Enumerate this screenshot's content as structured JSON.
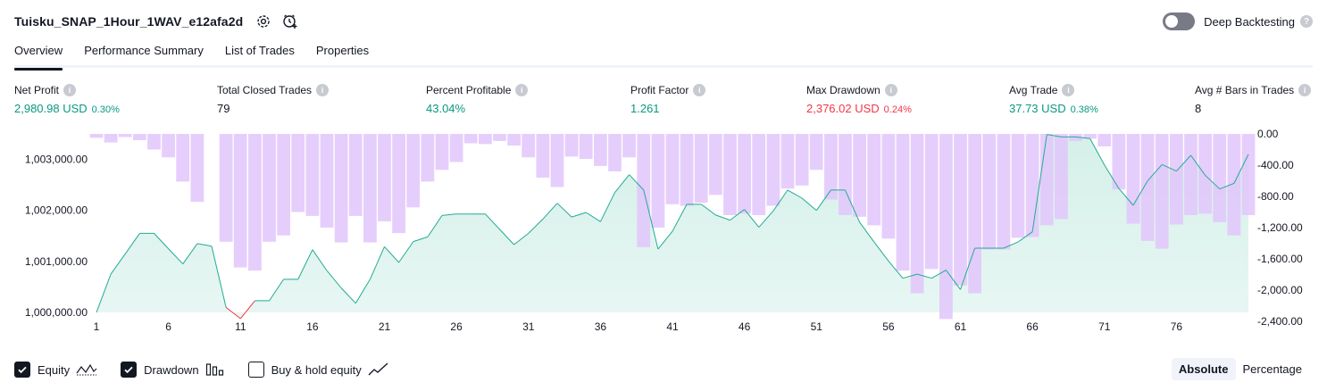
{
  "header": {
    "strategy_name": "Tuisku_SNAP_1Hour_1WAV_e12afa2d",
    "icons": [
      "settings-icon",
      "add-alert-icon"
    ]
  },
  "deep_backtesting": {
    "label": "Deep Backtesting",
    "enabled": false,
    "help": "?"
  },
  "tabs": [
    {
      "label": "Overview",
      "active": true
    },
    {
      "label": "Performance Summary",
      "active": false
    },
    {
      "label": "List of Trades",
      "active": false
    },
    {
      "label": "Properties",
      "active": false
    }
  ],
  "metrics": {
    "net_profit": {
      "label": "Net Profit",
      "value": "2,980.98 USD",
      "pct": "0.30%"
    },
    "total_closed_trades": {
      "label": "Total Closed Trades",
      "value": "79"
    },
    "percent_profitable": {
      "label": "Percent Profitable",
      "value": "43.04%"
    },
    "profit_factor": {
      "label": "Profit Factor",
      "value": "1.261"
    },
    "max_drawdown": {
      "label": "Max Drawdown",
      "value": "2,376.02 USD",
      "pct": "0.24%"
    },
    "avg_trade": {
      "label": "Avg Trade",
      "value": "37.73 USD",
      "pct": "0.38%"
    },
    "avg_bars": {
      "label": "Avg # Bars in Trades",
      "value": "8"
    }
  },
  "colors": {
    "equity_line": "#22ab94",
    "equity_fill": "#d5f0e9",
    "equity_negative": "#f23645",
    "drawdown_bar": "#e2c6fb",
    "drawdown_overlap": "#b9b5ec",
    "text_green": "#089981",
    "text_red": "#f23645"
  },
  "chart_data": {
    "type": "area",
    "x_ticks": [
      "1",
      "6",
      "11",
      "16",
      "21",
      "26",
      "31",
      "36",
      "41",
      "46",
      "51",
      "56",
      "61",
      "66",
      "71",
      "76"
    ],
    "y_left_ticks": [
      "1,000,000.00",
      "1,001,000.00",
      "1,002,000.00",
      "1,003,000.00"
    ],
    "y_left_values": [
      1000000,
      1001000,
      1002000,
      1003000
    ],
    "y_left_range": [
      1000000,
      1003500
    ],
    "y_right_ticks": [
      "0.00",
      "-400.00",
      "-800.00",
      "-1,200.00",
      "-1,600.00",
      "-2,000.00",
      "-2,400.00"
    ],
    "y_right_values": [
      0,
      -400,
      -800,
      -1200,
      -1600,
      -2000,
      -2400
    ],
    "y_right_range": [
      -2400,
      0
    ],
    "series": [
      {
        "name": "Equity",
        "type": "area",
        "values": [
          1000000,
          1000750,
          1001150,
          1001550,
          1001550,
          1001250,
          1000950,
          1001350,
          1001300,
          1000100,
          999880,
          1000230,
          1000230,
          1000650,
          1000650,
          1001230,
          1000820,
          1000480,
          1000180,
          1000650,
          1001290,
          1000980,
          1001390,
          1001480,
          1001900,
          1001930,
          1001930,
          1001930,
          1001630,
          1001330,
          1001550,
          1001830,
          1002140,
          1001870,
          1001960,
          1001780,
          1002350,
          1002700,
          1002400,
          1001240,
          1001590,
          1002120,
          1002120,
          1001910,
          1001810,
          1002020,
          1001670,
          1001990,
          1002400,
          1002240,
          1002000,
          1002400,
          1002400,
          1001770,
          1001380,
          1001010,
          1000670,
          1000750,
          1000670,
          1000830,
          1000450,
          1001260,
          1001260,
          1001260,
          1001380,
          1001580,
          1003490,
          1003440,
          1003440,
          1003410,
          1002890,
          1002430,
          1002100,
          1002580,
          1002900,
          1002770,
          1003080,
          1002690,
          1002420,
          1002530,
          1003100
        ]
      },
      {
        "name": "Drawdown",
        "type": "bar",
        "values": [
          -50,
          -110,
          -40,
          -80,
          -200,
          -300,
          -610,
          -870,
          0,
          -1380,
          -1710,
          -1750,
          -1380,
          -1300,
          -1000,
          -1050,
          -1200,
          -1390,
          -1050,
          -1390,
          -1120,
          -1270,
          -940,
          -610,
          -460,
          -360,
          -120,
          -130,
          -90,
          -150,
          -300,
          -560,
          -680,
          -290,
          -320,
          -410,
          -480,
          -300,
          -1450,
          -1200,
          -900,
          -920,
          -880,
          -780,
          -1040,
          -1020,
          -1040,
          -920,
          -700,
          -660,
          -460,
          -840,
          -1040,
          -1060,
          -1170,
          -1340,
          -1750,
          -2040,
          -1730,
          -2370,
          -1940,
          -2040,
          -1480,
          -1480,
          -1330,
          -1320,
          -1170,
          -1090,
          -90,
          -60,
          -160,
          -710,
          -1150,
          -1370,
          -1470,
          -1160,
          -1040,
          -1020,
          -1130,
          -1300,
          -1040
        ]
      }
    ],
    "legend": [
      {
        "name": "Equity",
        "checked": true
      },
      {
        "name": "Drawdown",
        "checked": true
      },
      {
        "name": "Buy & hold equity",
        "checked": false
      }
    ],
    "modes": [
      "Absolute",
      "Percentage"
    ],
    "active_mode": "Absolute"
  }
}
